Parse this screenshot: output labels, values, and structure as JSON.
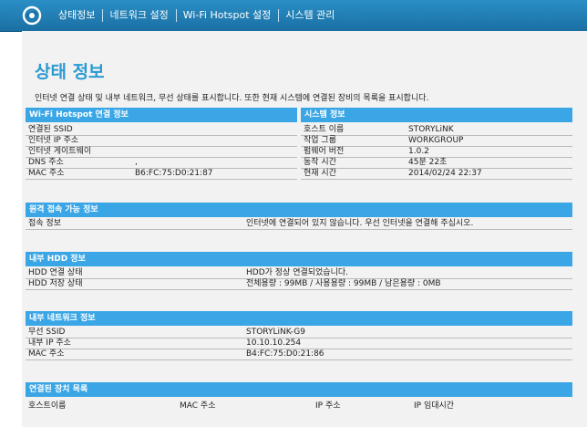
{
  "nav": {
    "items": [
      "상태정보",
      "네트워크 설정",
      "Wi-Fi Hotspot 설정",
      "시스템 관리"
    ]
  },
  "page": {
    "title": "상태 정보",
    "description": "인터넷 연결 상태 및 내부 네트워크, 무선 상태를 표시합니다. 또한 현재 시스템에 연결된 장비의 목록을 표시합니다."
  },
  "wifi_hotspot": {
    "header": "Wi-Fi Hotspot 연결 정보",
    "rows": [
      {
        "label": "연결된 SSID",
        "value": ""
      },
      {
        "label": "인터넷 IP 주소",
        "value": ""
      },
      {
        "label": "인터넷 게이트웨이",
        "value": ""
      },
      {
        "label": "DNS 주소",
        "value": ","
      },
      {
        "label": "MAC 주소",
        "value": "B6:FC:75:D0:21:87"
      }
    ]
  },
  "system": {
    "header": "시스템 정보",
    "rows": [
      {
        "label": "호스트 이름",
        "value": "STORYLiNK"
      },
      {
        "label": "작업 그룹",
        "value": "WORKGROUP"
      },
      {
        "label": "펌웨어 버전",
        "value": "1.0.2"
      },
      {
        "label": "동작 시간",
        "value": "45분 22초"
      },
      {
        "label": "현재 시간",
        "value": "2014/02/24 22:37"
      }
    ]
  },
  "remote_access": {
    "header": "원격 접속 가능 정보",
    "rows": [
      {
        "label": "접속 정보",
        "value": "인터넷에 연결되어 있지 않습니다. 우선 인터넷을 연결해 주십시오."
      }
    ]
  },
  "hdd": {
    "header": "내부 HDD 정보",
    "rows": [
      {
        "label": "HDD 연결 상태",
        "value": "HDD가 정상 연결되었습니다."
      },
      {
        "label": "HDD 저장 상태",
        "value": "전체용량 : 99MB / 사용용량 : 99MB / 남은용량 : 0MB"
      }
    ]
  },
  "internal_network": {
    "header": "내부 네트워크 정보",
    "rows": [
      {
        "label": "무선 SSID",
        "value": "STORYLiNK-G9"
      },
      {
        "label": "내부 IP 주소",
        "value": "10.10.10.254"
      },
      {
        "label": "MAC 주소",
        "value": "B4:FC:75:D0:21:86"
      }
    ]
  },
  "devices": {
    "header": "연결된 장치 목록",
    "columns": [
      "호스트이름",
      "MAC 주소",
      "IP 주소",
      "IP 임대시간"
    ]
  }
}
